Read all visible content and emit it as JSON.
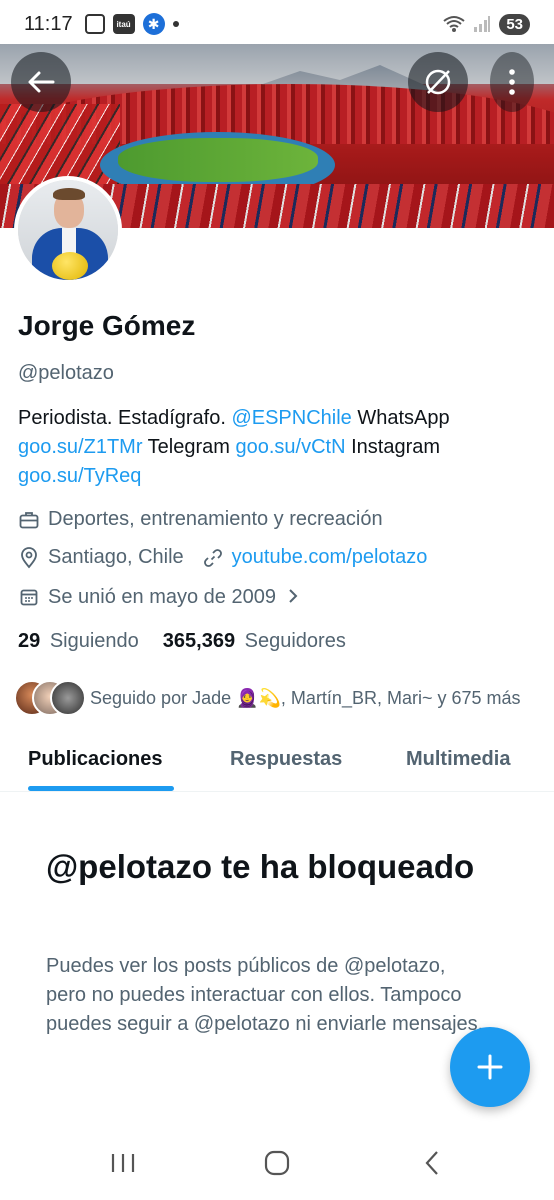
{
  "status_bar": {
    "time": "11:17",
    "itau_label": "itaú",
    "battery": "53"
  },
  "profile": {
    "name": "Jorge Gómez",
    "handle": "@pelotazo",
    "bio": {
      "t1": "Periodista. Estadígrafo. ",
      "l1": "@ESPNChile",
      "t2": " WhatsApp ",
      "l2": "goo.su/Z1TMr",
      "t3": " Telegram ",
      "l3": "goo.su/vCtN",
      "t4": " Instagram ",
      "l4": "goo.su/TyReq"
    },
    "category": "Deportes, entrenamiento y recreación",
    "location": "Santiago, Chile",
    "website": "youtube.com/pelotazo",
    "joined": "Se unió en mayo de 2009",
    "following_count": "29",
    "following_label": "Siguiendo",
    "followers_count": "365,369",
    "followers_label": "Seguidores",
    "followed_by": "Seguido por Jade 🧕💫, Martín_BR, Mari~ y 675 más"
  },
  "tabs": [
    "Publicaciones",
    "Respuestas",
    "Multimedia"
  ],
  "active_tab": "Publicaciones",
  "blocked": {
    "title": "@pelotazo te ha bloqueado",
    "text": "Puedes ver los posts públicos de @pelotazo, pero no puedes interactuar con ellos. Tampoco puedes seguir a @pelotazo ni enviarle mensajes."
  },
  "icons": {
    "back": "arrow-left-icon",
    "compass": "grok-compass-icon",
    "more": "more-vertical-icon",
    "category": "briefcase-icon",
    "location": "location-pin-icon",
    "website": "link-icon",
    "joined": "calendar-icon",
    "fab": "plus-icon",
    "nav_recents": "recents-icon",
    "nav_home": "home-icon",
    "nav_back": "back-chevron-icon"
  },
  "colors": {
    "accent": "#1d9bf0",
    "text_primary": "#0f1419",
    "text_secondary": "#536471"
  }
}
